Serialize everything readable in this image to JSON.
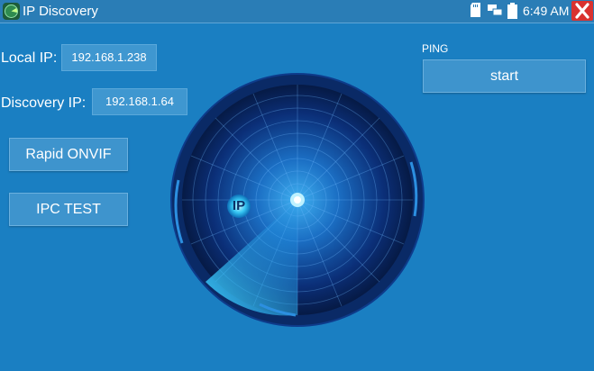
{
  "window": {
    "title": "IP Discovery",
    "time": "6:49 AM",
    "status_icons": [
      "sd-card-icon",
      "network-icon",
      "battery-icon"
    ],
    "close_icon": "close-icon"
  },
  "local_ip": {
    "label": "Local IP:",
    "value": "192.168.1.238"
  },
  "discovery_ip": {
    "label": "Discovery IP:",
    "value": "192.168.1.64"
  },
  "buttons": {
    "rapid_onvif": "Rapid ONVIF",
    "ipc_test": "IPC TEST"
  },
  "ping": {
    "label": "PING",
    "start_label": "start"
  },
  "radar": {
    "marker_label": "IP"
  },
  "colors": {
    "background": "#1a7fc2",
    "button": "#3e94cd",
    "close": "#d9322f"
  }
}
